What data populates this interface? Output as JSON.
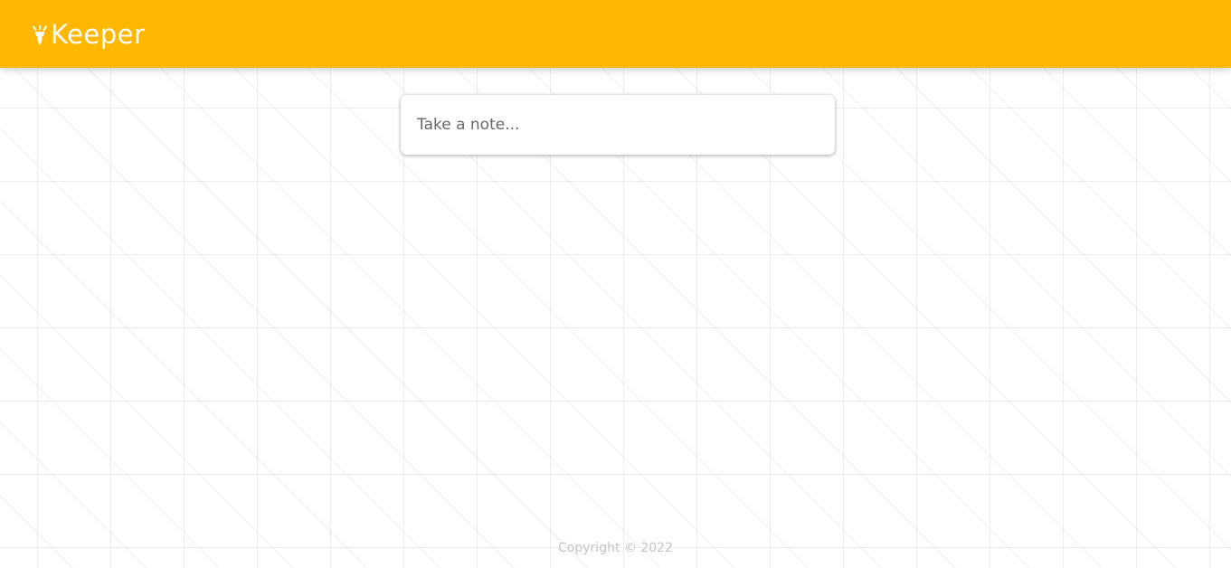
{
  "header": {
    "title": "Keeper",
    "logo_icon": "highlighter-icon",
    "background_color": "#ffb700"
  },
  "create_area": {
    "placeholder": "Take a note...",
    "value": ""
  },
  "footer": {
    "copyright": "Copyright © 2022"
  }
}
